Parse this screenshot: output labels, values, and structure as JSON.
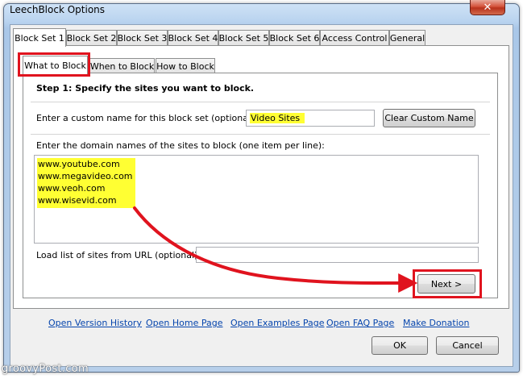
{
  "window": {
    "title": "LeechBlock Options",
    "close_glyph": "✕"
  },
  "top_tabs": [
    {
      "label": "Block Set 1"
    },
    {
      "label": "Block Set 2"
    },
    {
      "label": "Block Set 3"
    },
    {
      "label": "Block Set 4"
    },
    {
      "label": "Block Set 5"
    },
    {
      "label": "Block Set 6"
    },
    {
      "label": "Access Control"
    },
    {
      "label": "General"
    }
  ],
  "inner_tabs": [
    {
      "label": "What to Block"
    },
    {
      "label": "When to Block"
    },
    {
      "label": "How to Block"
    }
  ],
  "content": {
    "step_heading": "Step 1: Specify the sites you want to block.",
    "custom_name_label": "Enter a custom name for this block set (optional):",
    "custom_name_value": "Video Sites",
    "clear_button": "Clear Custom Name",
    "domains_label": "Enter the domain names of the sites to block (one item per line):",
    "domains": [
      "www.youtube.com",
      "www.megavideo.com",
      "www.veoh.com",
      "www.wisevid.com"
    ],
    "load_url_label": "Load list of sites from URL (optional):",
    "load_url_value": "",
    "next_button": "Next >"
  },
  "links": [
    {
      "label": "Open Version History"
    },
    {
      "label": "Open Home Page"
    },
    {
      "label": "Open Examples Page"
    },
    {
      "label": "Open FAQ Page"
    },
    {
      "label": "Make Donation"
    }
  ],
  "footer": {
    "ok_button": "OK",
    "cancel_button": "Cancel"
  },
  "watermark": "groovyPost.com",
  "colors": {
    "highlight": "#ffff33",
    "annotation_red": "#e0131e",
    "link": "#0645ad"
  }
}
